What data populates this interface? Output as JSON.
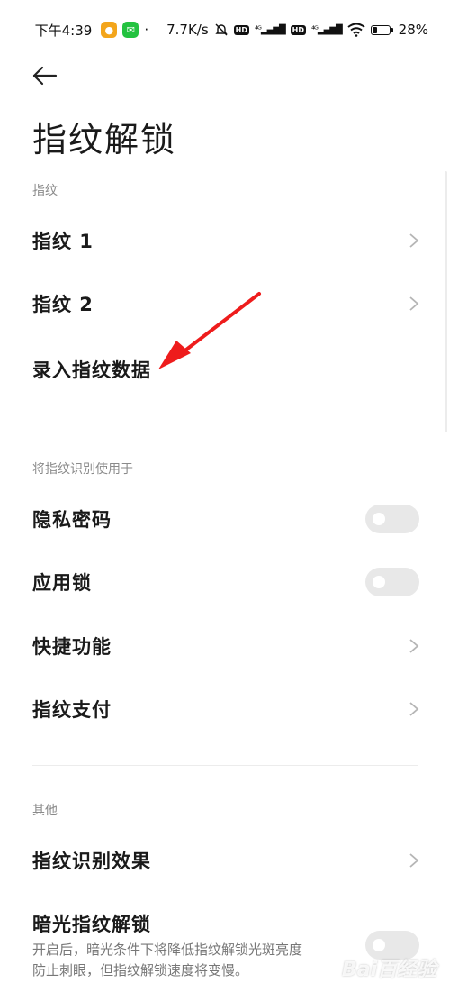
{
  "status_bar": {
    "time": "下午4:39",
    "network_speed": "7.7K/s",
    "battery": "28%",
    "icons": [
      "cat-app-icon",
      "wechat-icon",
      "mute-bell-icon",
      "hd-icon",
      "signal-4g-icon",
      "wifi-icon",
      "battery-icon"
    ]
  },
  "header": {
    "title": "指纹解锁"
  },
  "sections": {
    "fingerprints": {
      "title": "指纹",
      "items": [
        {
          "label": "指纹 1"
        },
        {
          "label": "指纹 2"
        },
        {
          "label": "录入指纹数据"
        }
      ]
    },
    "usage": {
      "title": "将指纹识别使用于",
      "items": [
        {
          "label": "隐私密码",
          "type": "toggle",
          "on": false
        },
        {
          "label": "应用锁",
          "type": "toggle",
          "on": false
        },
        {
          "label": "快捷功能",
          "type": "link"
        },
        {
          "label": "指纹支付",
          "type": "link"
        }
      ]
    },
    "other": {
      "title": "其他",
      "items": [
        {
          "label": "指纹识别效果",
          "type": "link"
        },
        {
          "label": "暗光指纹解锁",
          "type": "toggle",
          "on": false,
          "description_line1": "开启后，暗光条件下将降低指纹解锁光斑亮度",
          "description_line2": "防止刺眼，但指纹解锁速度将变慢。"
        }
      ]
    }
  },
  "colors": {
    "annotation_arrow": "#ee1c1c",
    "toggle_off": "#e8e8e8",
    "section_title": "#8a8a8a"
  },
  "watermark": "Bai百经验"
}
